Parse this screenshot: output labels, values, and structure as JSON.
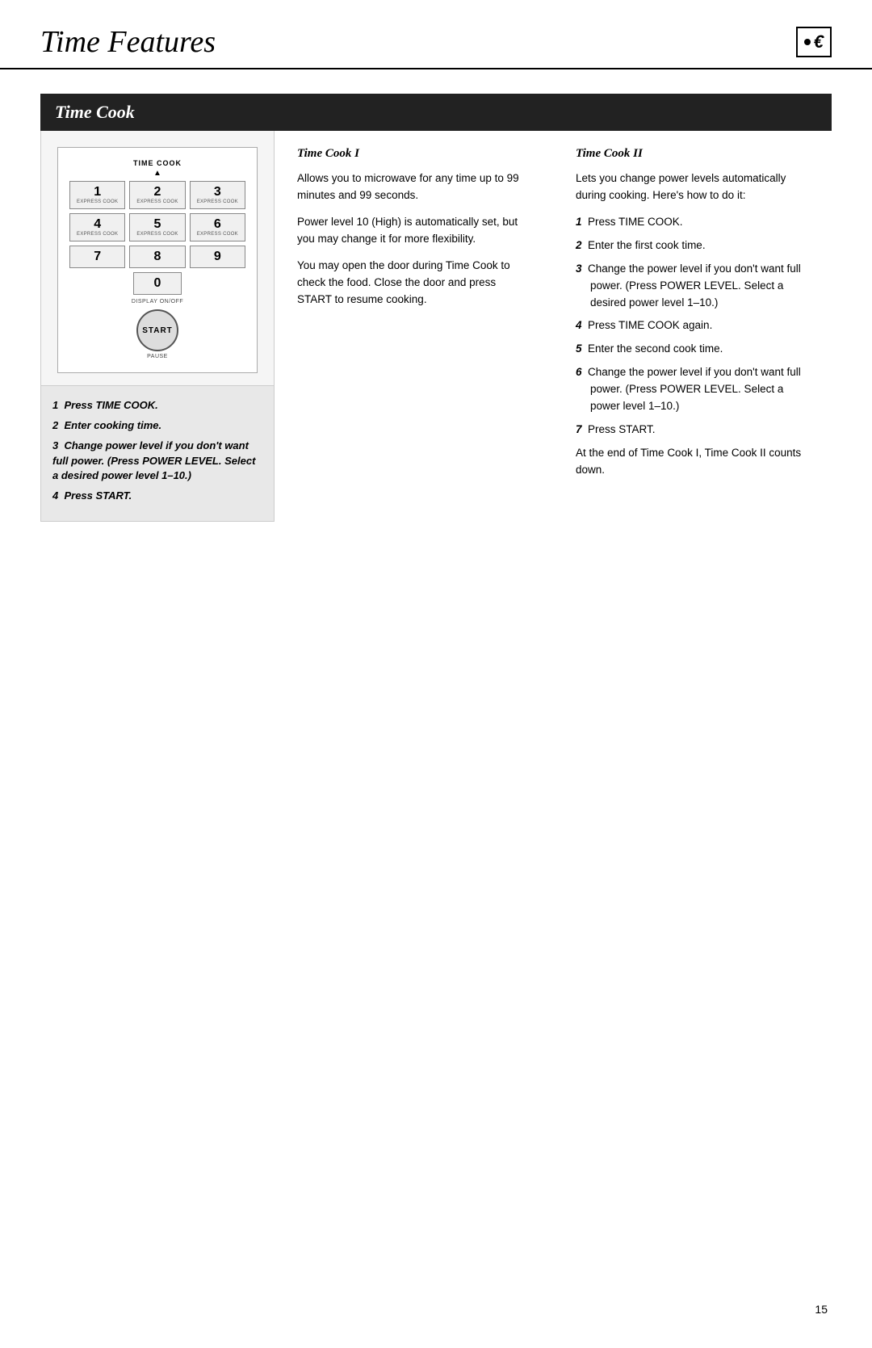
{
  "header": {
    "title": "Time Features",
    "icon_dot": "●",
    "icon_arrow": "€"
  },
  "section": {
    "title": "Time Cook"
  },
  "keypad": {
    "time_cook_label": "TIME COOK",
    "keys": [
      {
        "num": "1",
        "sub": "EXPRESS COOK"
      },
      {
        "num": "2",
        "sub": "EXPRESS COOK"
      },
      {
        "num": "3",
        "sub": "EXPRESS COOK"
      },
      {
        "num": "4",
        "sub": "EXPRESS COOK"
      },
      {
        "num": "5",
        "sub": "EXPRESS COOK"
      },
      {
        "num": "6",
        "sub": "EXPRESS COOK"
      },
      {
        "num": "7",
        "sub": ""
      },
      {
        "num": "8",
        "sub": ""
      },
      {
        "num": "9",
        "sub": ""
      },
      {
        "num": "0",
        "sub": ""
      }
    ],
    "display_off": "DISPLAY ON/OFF",
    "start_label": "START",
    "pause_label": "PAUSE"
  },
  "instructions": {
    "items": [
      {
        "num": "1",
        "text": "Press TIME COOK."
      },
      {
        "num": "2",
        "text": "Enter cooking time."
      },
      {
        "num": "3",
        "text": "Change power level if you don't want full power. (Press POWER LEVEL. Select a desired power level 1–10.)"
      },
      {
        "num": "4",
        "text": "Press START."
      }
    ]
  },
  "timecook1": {
    "subtitle": "Time Cook I",
    "para1": "Allows you to microwave for any time up to 99 minutes and 99 seconds.",
    "para2": "Power level 10 (High) is automatically set, but you may change it for more flexibility.",
    "para3": "You may open the door during Time Cook to check the food. Close the door and press START to resume cooking."
  },
  "timecook2": {
    "subtitle": "Time Cook II",
    "intro": "Lets you change power levels automatically during cooking. Here's how to do it:",
    "steps": [
      {
        "num": "1",
        "text": "Press TIME COOK."
      },
      {
        "num": "2",
        "text": "Enter the first cook time."
      },
      {
        "num": "3",
        "text": "Change the power level if you don't want full power. (Press POWER LEVEL. Select a desired power level 1–10.)"
      },
      {
        "num": "4",
        "text": "Press TIME COOK again."
      },
      {
        "num": "5",
        "text": "Enter the second cook time."
      },
      {
        "num": "6",
        "text": "Change the power level if you don't want full power. (Press POWER LEVEL. Select a power level 1–10.)"
      },
      {
        "num": "7",
        "text": "Press START."
      }
    ],
    "closing": "At the end of Time Cook I, Time Cook II counts down."
  },
  "page_number": "15"
}
